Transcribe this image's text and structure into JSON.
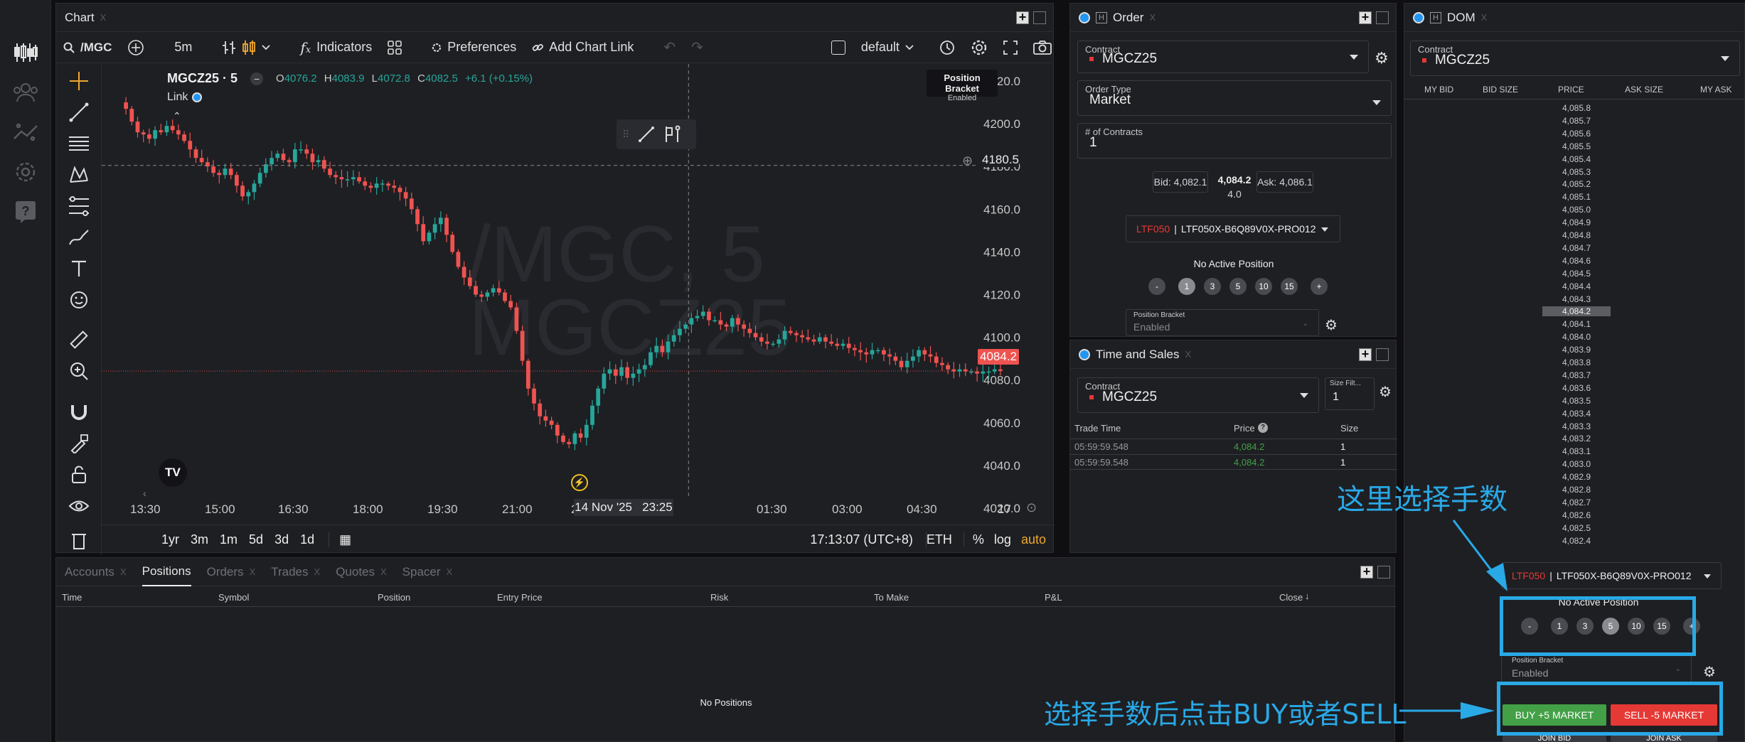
{
  "rail": {
    "icons": [
      "chart-icon",
      "users-icon",
      "analytics-icon",
      "gear-icon",
      "help-icon"
    ]
  },
  "chart": {
    "tab": "Chart",
    "symbol_search": "/MGC",
    "interval": "5m",
    "indicators_label": "Indicators",
    "preferences_label": "Preferences",
    "add_chart_link_label": "Add Chart Link",
    "layout_label": "default",
    "legend_symbol": "MGCZ25 · 5",
    "ohlc": {
      "o_label": "O",
      "o": "4076.2",
      "h_label": "H",
      "h": "4083.9",
      "l_label": "L",
      "l": "4072.8",
      "c_label": "C",
      "c": "4082.5",
      "chg": "+6.1 (+0.15%)"
    },
    "link_label": "Link",
    "watermark_1": "/MGC, 5",
    "watermark_2": "MGCZ25",
    "position_bracket_title": "Position Bracket",
    "position_bracket_status": "Enabled",
    "crosshair_price": "4180.5",
    "last_price": "4084.2",
    "crosshair_time": "14 Nov '25   23:25",
    "clock": "17:13:07 (UTC+8)",
    "session": "ETH",
    "percent_label": "%",
    "log_label": "log",
    "auto_label": "auto",
    "ranges": [
      "1yr",
      "3m",
      "1m",
      "5d",
      "3d",
      "1d"
    ],
    "price_ticks": [
      "4220.0",
      "4200.0",
      "4180.0",
      "4160.0",
      "4140.0",
      "4120.0",
      "4100.0",
      "4080.0",
      "4060.0",
      "4040.0",
      "4020.0"
    ],
    "time_ticks": [
      "13:30",
      "15:00",
      "16:30",
      "18:00",
      "19:30",
      "21:00",
      "22",
      "01:30",
      "03:00",
      "04:30",
      "17"
    ],
    "tv_logo": "TV"
  },
  "chart_data": {
    "type": "candlestick",
    "title": "",
    "xlabel": "",
    "ylabel": "",
    "ylim": [
      4015,
      4228
    ],
    "x_start": "13:10",
    "x_end": "05:30",
    "closes": [
      4207,
      4201,
      4196,
      4195,
      4193,
      4197,
      4196,
      4199,
      4197,
      4195,
      4192,
      4188,
      4184,
      4182,
      4180,
      4177,
      4176,
      4179,
      4176,
      4171,
      4166,
      4168,
      4172,
      4177,
      4181,
      4184,
      4186,
      4183,
      4182,
      4188,
      4188,
      4186,
      4182,
      4183,
      4179,
      4176,
      4175,
      4174,
      4174,
      4175,
      4173,
      4171,
      4170,
      4172,
      4172,
      4171,
      4170,
      4168,
      4165,
      4160,
      4153,
      4145,
      4149,
      4153,
      4156,
      4148,
      4140,
      4133,
      4128,
      4124,
      4120,
      4119,
      4121,
      4123,
      4121,
      4117,
      4114,
      4103,
      4089,
      4076,
      4069,
      4063,
      4061,
      4059,
      4054,
      4051,
      4050,
      4055,
      4053,
      4059,
      4068,
      4076,
      4083,
      4085,
      4082,
      4086,
      4081,
      4083,
      4085,
      4087,
      4093,
      4096,
      4093,
      4098,
      4101,
      4104,
      4106,
      4109,
      4110,
      4112,
      4108,
      4108,
      4106,
      4105,
      4109,
      4106,
      4104,
      4102,
      4100,
      4098,
      4097,
      4097,
      4099,
      4103,
      4102,
      4101,
      4100,
      4099,
      4098,
      4100,
      4098,
      4097,
      4096,
      4097,
      4095,
      4094,
      4093,
      4092,
      4094,
      4094,
      4092,
      4091,
      4089,
      4086,
      4089,
      4091,
      4094,
      4092,
      4091,
      4088,
      4087,
      4085,
      4084,
      4085,
      4084,
      4084,
      4083,
      4084,
      4084,
      4085,
      4084.2
    ]
  },
  "order": {
    "tab": "Order",
    "contract_label": "Contract",
    "contract": "MGCZ25",
    "order_type_label": "Order Type",
    "order_type": "Market",
    "contracts_label": "# of Contracts",
    "contracts": "1",
    "bid": "Bid: 4,082.1",
    "mid_price": "4,084.2",
    "spread": "4.0",
    "ask": "Ask: 4,086.1",
    "account_prefix": "LTF050",
    "account": "LTF050X-B6Q89V0X-PRO012",
    "no_position": "No Active Position",
    "qty_buttons": [
      "-",
      "1",
      "3",
      "5",
      "10",
      "15",
      "+"
    ],
    "bracket_label": "Position Bracket",
    "bracket_value": "Enabled"
  },
  "ts": {
    "tab": "Time and Sales",
    "contract_label": "Contract",
    "contract": "MGCZ25",
    "size_filter_label": "Size Filt...",
    "size_filter": "1",
    "headers": [
      "Trade Time",
      "Price",
      "Size"
    ],
    "rows": [
      {
        "time": "05:59:59.548",
        "price": "4,084.2",
        "size": "1"
      },
      {
        "time": "05:59:59.548",
        "price": "4,084.2",
        "size": "1"
      }
    ]
  },
  "positions": {
    "tabs": [
      "Accounts",
      "Positions",
      "Orders",
      "Trades",
      "Quotes",
      "Spacer"
    ],
    "active_tab": "Positions",
    "columns": [
      "Time",
      "Symbol",
      "Position",
      "Entry Price",
      "Risk",
      "To Make",
      "P&L",
      "Close"
    ],
    "empty": "No Positions"
  },
  "dom": {
    "tab": "DOM",
    "contract_label": "Contract",
    "contract": "MGCZ25",
    "headers": [
      "MY BID",
      "BID SIZE",
      "PRICE",
      "ASK SIZE",
      "MY ASK"
    ],
    "prices": [
      "4,085.8",
      "4,085.7",
      "4,085.6",
      "4,085.5",
      "4,085.4",
      "4,085.3",
      "4,085.2",
      "4,085.1",
      "4,085.0",
      "4,084.9",
      "4,084.8",
      "4,084.7",
      "4,084.6",
      "4,084.5",
      "4,084.4",
      "4,084.3",
      "4,084.2",
      "4,084.1",
      "4,084.0",
      "4,083.9",
      "4,083.8",
      "4,083.7",
      "4,083.6",
      "4,083.5",
      "4,083.4",
      "4,083.3",
      "4,083.2",
      "4,083.1",
      "4,083.0",
      "4,082.9",
      "4,082.8",
      "4,082.7",
      "4,082.6",
      "4,082.5",
      "4,082.4"
    ],
    "current_price": "4,084.2",
    "account_prefix": "LTF050",
    "account": "LTF050X-B6Q89V0X-PRO012",
    "no_position": "No Active Position",
    "qty_buttons": [
      "-",
      "1",
      "3",
      "5",
      "10",
      "15",
      "+"
    ],
    "bracket_label": "Position Bracket",
    "bracket_value": "Enabled",
    "buy_label": "BUY +5 MARKET",
    "sell_label": "SELL -5 MARKET",
    "join_bid": "JOIN BID",
    "join_ask": "JOIN ASK"
  },
  "annotations": {
    "select_qty": "这里选择手数",
    "click_buy_sell": "选择手数后点击BUY或者SELL"
  },
  "colors": {
    "up": "#26a69a",
    "down": "#ef5350",
    "accent": "#29a9e6",
    "buy": "#43a047",
    "sell": "#e53935"
  }
}
